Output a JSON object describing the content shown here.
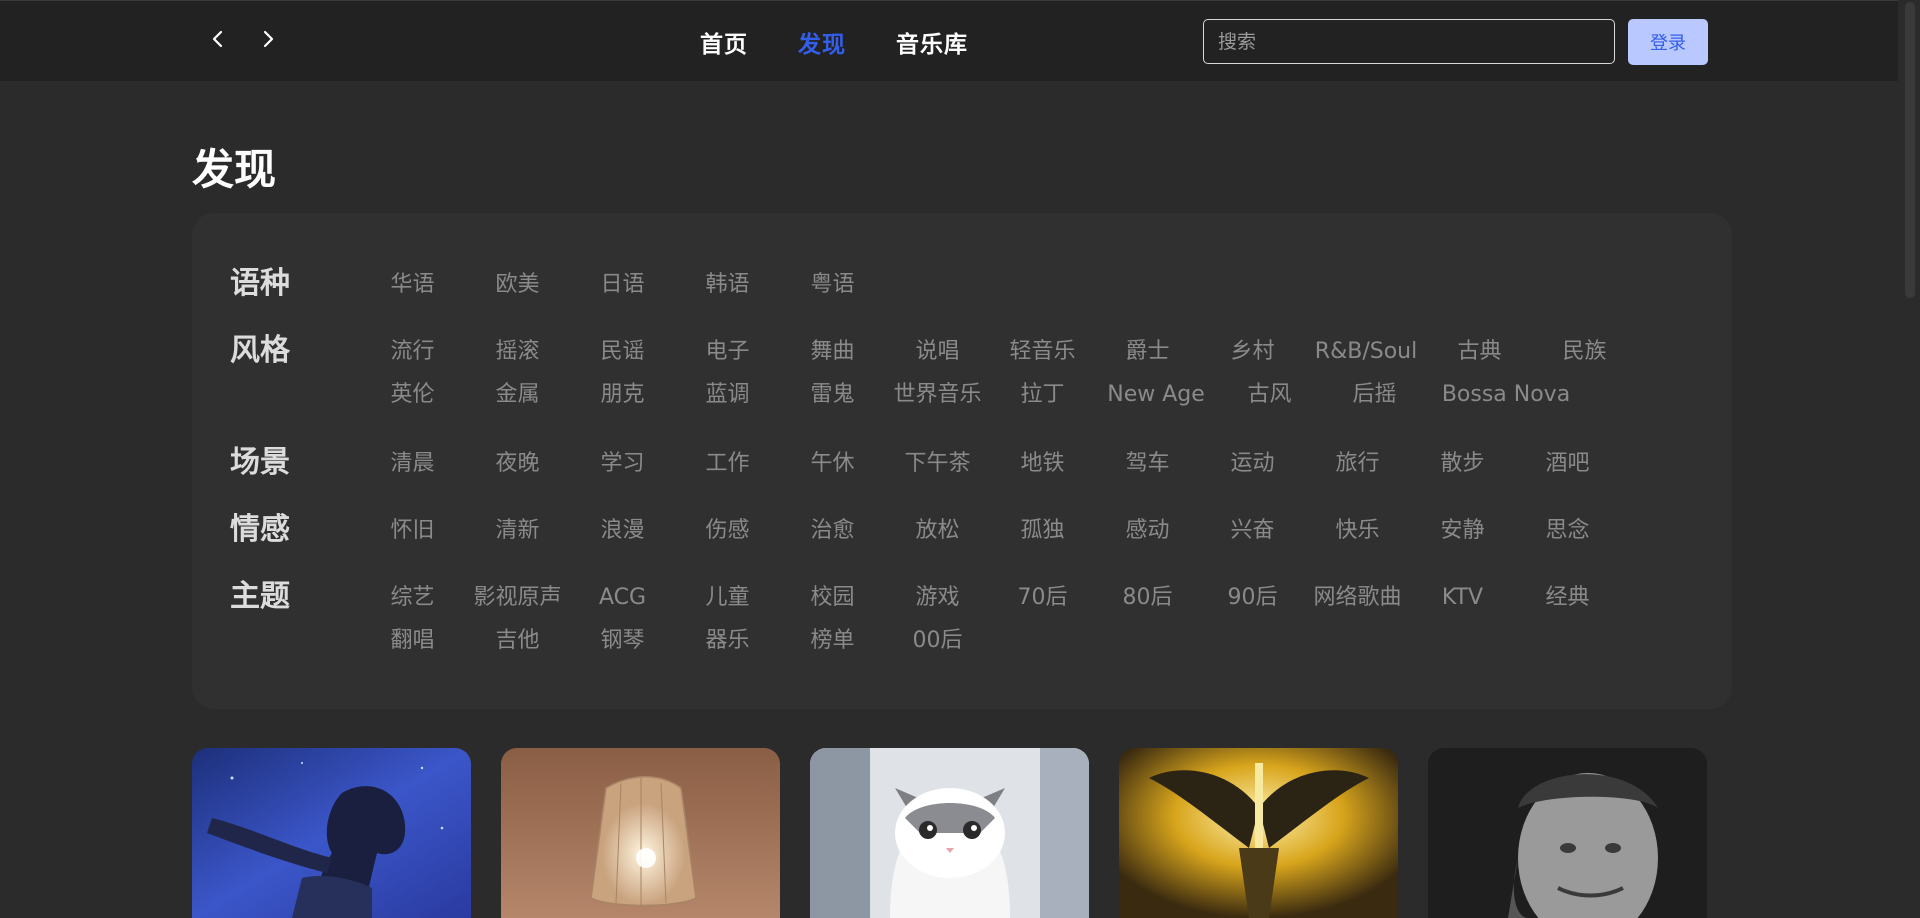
{
  "header": {
    "nav": [
      {
        "label": "首页",
        "active": false
      },
      {
        "label": "发现",
        "active": true
      },
      {
        "label": "音乐库",
        "active": false
      }
    ],
    "search_placeholder": "搜索",
    "login_label": "登录",
    "back_icon": "chevron-left-icon",
    "forward_icon": "chevron-right-icon",
    "accent_color": "#335eea"
  },
  "page": {
    "title": "发现"
  },
  "categories": [
    {
      "label": "语种",
      "options": [
        "华语",
        "欧美",
        "日语",
        "韩语",
        "粤语"
      ]
    },
    {
      "label": "风格",
      "options": [
        "流行",
        "摇滚",
        "民谣",
        "电子",
        "舞曲",
        "说唱",
        "轻音乐",
        "爵士",
        "乡村",
        "R&B/Soul",
        "古典",
        "民族",
        "英伦",
        "金属",
        "朋克",
        "蓝调",
        "雷鬼",
        "世界音乐",
        "拉丁",
        "New Age",
        "古风",
        "后摇",
        "Bossa Nova"
      ]
    },
    {
      "label": "场景",
      "options": [
        "清晨",
        "夜晚",
        "学习",
        "工作",
        "午休",
        "下午茶",
        "地铁",
        "驾车",
        "运动",
        "旅行",
        "散步",
        "酒吧"
      ]
    },
    {
      "label": "情感",
      "options": [
        "怀旧",
        "清新",
        "浪漫",
        "伤感",
        "治愈",
        "放松",
        "孤独",
        "感动",
        "兴奋",
        "快乐",
        "安静",
        "思念"
      ]
    },
    {
      "label": "主题",
      "options": [
        "综艺",
        "影视原声",
        "ACG",
        "儿童",
        "校园",
        "游戏",
        "70后",
        "80后",
        "90后",
        "网络歌曲",
        "KTV",
        "经典",
        "翻唱",
        "吉他",
        "钢琴",
        "器乐",
        "榜单",
        "00后"
      ]
    }
  ],
  "cards": [
    {
      "image": "anime-girl-night-sky-cover"
    },
    {
      "image": "lamp-cover"
    },
    {
      "image": "kitten-cover"
    },
    {
      "image": "golden-winged-figure-cover"
    },
    {
      "image": "vintage-portrait-cover"
    }
  ]
}
